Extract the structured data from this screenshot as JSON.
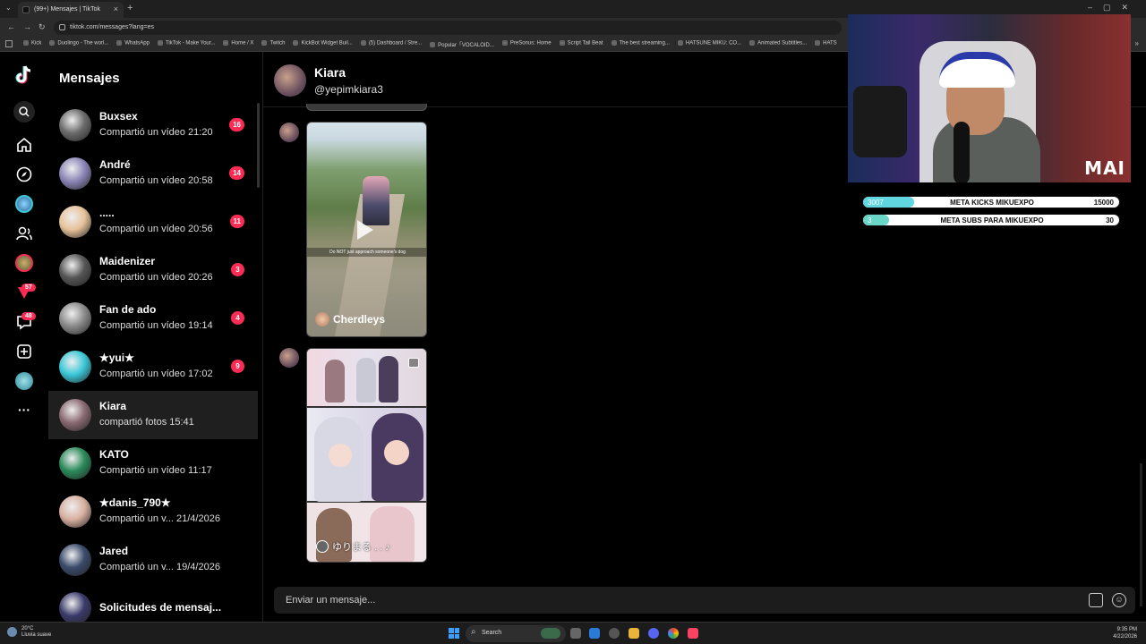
{
  "browser": {
    "tab_title": "(99+) Mensajes | TikTok",
    "url": "tiktok.com/messages?lang=es",
    "bookmarks": [
      "Kick",
      "Duolingo - The worl...",
      "WhatsApp",
      "TikTok - Make Your...",
      "Home / X",
      "Twitch",
      "KickBot Widget Buil...",
      "(5) Dashboard / Stre...",
      "Popular「VOCALOID...",
      "PreSonus: Home",
      "Script Tail Beat",
      "The best streaming...",
      "HATSUNE MIKU: CO...",
      "Animated Subtitles...",
      "HATS"
    ]
  },
  "rail": {
    "icons": [
      "tiktok-logo-icon",
      "search-icon",
      "home-icon",
      "explore-icon",
      "live-avatar-icon",
      "following-icon",
      "friends-avatar-icon",
      "inbox-icon",
      "messages-icon",
      "upload-icon",
      "profile-avatar-icon",
      "more-icon"
    ],
    "activity_badge": "57",
    "messages_badge": "48"
  },
  "messages": {
    "title": "Mensajes",
    "conversations": [
      {
        "name": "Buxsex",
        "preview": "Compartió un vídeo 21:20",
        "badge": "16",
        "color": "#6b6b6b"
      },
      {
        "name": "André",
        "preview": "Compartió un vídeo 20:58",
        "badge": "14",
        "color": "#8b86b8"
      },
      {
        "name": ".....",
        "preview": "Compartió un vídeo 20:56",
        "badge": "11",
        "color": "#e6c29a"
      },
      {
        "name": "Maidenizer",
        "preview": "Compartió un vídeo 20:26",
        "badge": "3",
        "color": "#555555"
      },
      {
        "name": "Fan de ado",
        "preview": "Compartió un vídeo 19:14",
        "badge": "4",
        "color": "#8a8a8a"
      },
      {
        "name": "★yui★",
        "preview": "Compartió un vídeo 17:02",
        "badge": "9",
        "color": "#3ac8d8"
      },
      {
        "name": "Kiara",
        "preview": "compartió fotos 15:41",
        "badge": "",
        "color": "#8a6a72"
      },
      {
        "name": "KATO",
        "preview": "Compartió un vídeo 11:17",
        "badge": "",
        "color": "#2a8a5a"
      },
      {
        "name": "★danis_790★",
        "preview": "Compartió un v... 21/4/2026",
        "badge": "",
        "color": "#d8b0a0"
      },
      {
        "name": "Jared",
        "preview": "Compartió un v... 19/4/2026",
        "badge": "",
        "color": "#3a4a6a"
      },
      {
        "name": "Solicitudes de mensaj...",
        "preview": "",
        "badge": "",
        "color": "#3a3a6a"
      }
    ]
  },
  "chat": {
    "name": "Kiara",
    "handle": "@yepimkiara3",
    "video_caption": "Do NOT just approach someone's dog",
    "video_author": "Cherdleys",
    "art_author": "ゆりまる . . ♪",
    "composer_placeholder": "Enviar un mensaje..."
  },
  "overlay": {
    "logo": "MAI",
    "goals": [
      {
        "current": "3007",
        "label": "META KICKS MIKUEXPO",
        "target": "15000",
        "progress": 0.2,
        "color": "#5fd6e0"
      },
      {
        "current": "3",
        "label": "META SUBS PARA MIKUEXPO",
        "target": "30",
        "progress": 0.1,
        "color": "#6ad6c8"
      }
    ]
  },
  "taskbar": {
    "weather_temp": "20°C",
    "weather_desc": "Lluvia suave",
    "search_label": "Search",
    "time": "9:35 PM",
    "date": "4/22/2026"
  }
}
